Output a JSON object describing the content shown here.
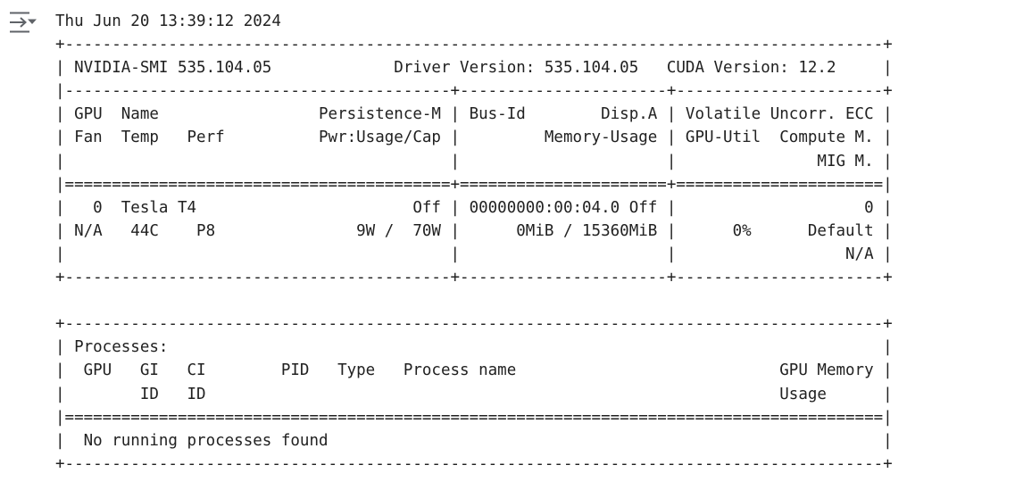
{
  "output_toggle": {
    "icon": "collapse-output-icon"
  },
  "terminal": {
    "lines": [
      "Thu Jun 20 13:39:12 2024       ",
      "+---------------------------------------------------------------------------------------+",
      "| NVIDIA-SMI 535.104.05             Driver Version: 535.104.05   CUDA Version: 12.2     |",
      "|-----------------------------------------+----------------------+----------------------+",
      "| GPU  Name                 Persistence-M | Bus-Id        Disp.A | Volatile Uncorr. ECC |",
      "| Fan  Temp   Perf          Pwr:Usage/Cap |         Memory-Usage | GPU-Util  Compute M. |",
      "|                                         |                      |               MIG M. |",
      "|=========================================+======================+======================|",
      "|   0  Tesla T4                       Off | 00000000:00:04.0 Off |                    0 |",
      "| N/A   44C    P8               9W /  70W |      0MiB / 15360MiB |      0%      Default |",
      "|                                         |                      |                  N/A |",
      "+-----------------------------------------+----------------------+----------------------+",
      "                                                                                         ",
      "+---------------------------------------------------------------------------------------+",
      "| Processes:                                                                            |",
      "|  GPU   GI   CI        PID   Type   Process name                            GPU Memory |",
      "|        ID   ID                                                             Usage      |",
      "|=======================================================================================|",
      "|  No running processes found                                                           |",
      "+---------------------------------------------------------------------------------------+"
    ]
  }
}
